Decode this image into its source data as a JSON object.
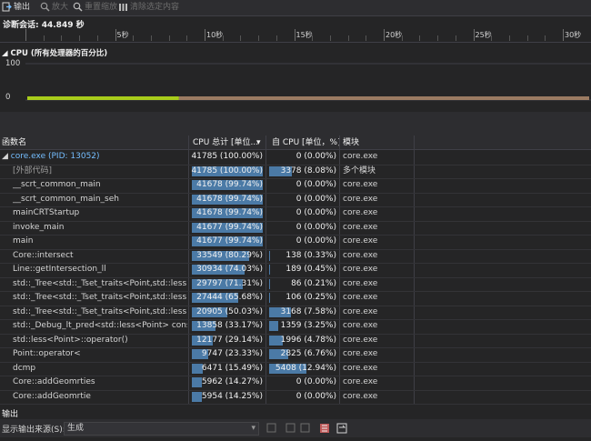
{
  "toolbar": {
    "export": "输出",
    "zoom_in": "放大",
    "reset_zoom": "重置缩放",
    "clear_selection": "清除选定内容"
  },
  "session": "诊断会话: 44.849 秒",
  "timeline": {
    "labels": [
      "5秒",
      "10秒",
      "15秒",
      "20秒",
      "25秒",
      "30秒"
    ]
  },
  "cpu_chart": {
    "title": "CPU (所有处理器的百分比)",
    "y_max": "100",
    "y_min": "0",
    "colors": {
      "active": "#a8cc1b",
      "idle": "#9b7b62"
    },
    "active_fraction": 0.27
  },
  "table": {
    "headers": {
      "name": "函数名",
      "total": "CPU 总计 [单位...",
      "self": "自 CPU [单位，%]",
      "module": "模块"
    },
    "rows": [
      {
        "name": "core.exe (PID: 13052)",
        "total": "41785 (100.00%)",
        "total_pct": 100.0,
        "self": "0 (0.00%)",
        "self_pct": 0.0,
        "module": "core.exe",
        "root": true
      },
      {
        "name": "[外部代码]",
        "total": "41785 (100.00%)",
        "total_pct": 100.0,
        "self": "3378 (8.08%)",
        "self_pct": 8.08,
        "module": "多个模块",
        "dim": true
      },
      {
        "name": "__scrt_common_main",
        "total": "41678 (99.74%)",
        "total_pct": 99.74,
        "self": "0 (0.00%)",
        "self_pct": 0.0,
        "module": "core.exe"
      },
      {
        "name": "__scrt_common_main_seh",
        "total": "41678 (99.74%)",
        "total_pct": 99.74,
        "self": "0 (0.00%)",
        "self_pct": 0.0,
        "module": "core.exe"
      },
      {
        "name": "mainCRTStartup",
        "total": "41678 (99.74%)",
        "total_pct": 99.74,
        "self": "0 (0.00%)",
        "self_pct": 0.0,
        "module": "core.exe"
      },
      {
        "name": "invoke_main",
        "total": "41677 (99.74%)",
        "total_pct": 99.74,
        "self": "0 (0.00%)",
        "self_pct": 0.0,
        "module": "core.exe"
      },
      {
        "name": "main",
        "total": "41677 (99.74%)",
        "total_pct": 99.74,
        "self": "0 (0.00%)",
        "self_pct": 0.0,
        "module": "core.exe"
      },
      {
        "name": "Core::intersect",
        "total": "33549 (80.29%)",
        "total_pct": 80.29,
        "self": "138 (0.33%)",
        "self_pct": 0.33,
        "module": "core.exe"
      },
      {
        "name": "Line::getIntersection_ll",
        "total": "30934 (74.03%)",
        "total_pct": 74.03,
        "self": "189 (0.45%)",
        "self_pct": 0.45,
        "module": "core.exe"
      },
      {
        "name": "std::_Tree<std::_Tset_traits<Point,std::less<Po...",
        "total": "29797 (71.31%)",
        "total_pct": 71.31,
        "self": "86 (0.21%)",
        "self_pct": 0.21,
        "module": "core.exe"
      },
      {
        "name": "std::_Tree<std::_Tset_traits<Point,std::less<Po...",
        "total": "27444 (65.68%)",
        "total_pct": 65.68,
        "self": "106 (0.25%)",
        "self_pct": 0.25,
        "module": "core.exe"
      },
      {
        "name": "std::_Tree<std::_Tset_traits<Point,std::less<Po...",
        "total": "20905 (50.03%)",
        "total_pct": 50.03,
        "self": "3168 (7.58%)",
        "self_pct": 7.58,
        "module": "core.exe"
      },
      {
        "name": "std::_Debug_lt_pred<std::less<Point> const...",
        "total": "13858 (33.17%)",
        "total_pct": 33.17,
        "self": "1359 (3.25%)",
        "self_pct": 3.25,
        "module": "core.exe"
      },
      {
        "name": "std::less<Point>::operator()",
        "total": "12177 (29.14%)",
        "total_pct": 29.14,
        "self": "1996 (4.78%)",
        "self_pct": 4.78,
        "module": "core.exe"
      },
      {
        "name": "Point::operator<",
        "total": "9747 (23.33%)",
        "total_pct": 23.33,
        "self": "2825 (6.76%)",
        "self_pct": 6.76,
        "module": "core.exe"
      },
      {
        "name": "dcmp",
        "total": "6471 (15.49%)",
        "total_pct": 15.49,
        "self": "5408 (12.94%)",
        "self_pct": 12.94,
        "module": "core.exe"
      },
      {
        "name": "Core::addGeomrties",
        "total": "5962 (14.27%)",
        "total_pct": 14.27,
        "self": "0 (0.00%)",
        "self_pct": 0.0,
        "module": "core.exe"
      },
      {
        "name": "Core::addGeomrtie",
        "total": "5954 (14.25%)",
        "total_pct": 14.25,
        "self": "0 (0.00%)",
        "self_pct": 0.0,
        "module": "core.exe"
      }
    ]
  },
  "output": {
    "title": "输出",
    "source_label": "显示输出来源(S):",
    "source_value": "生成"
  }
}
